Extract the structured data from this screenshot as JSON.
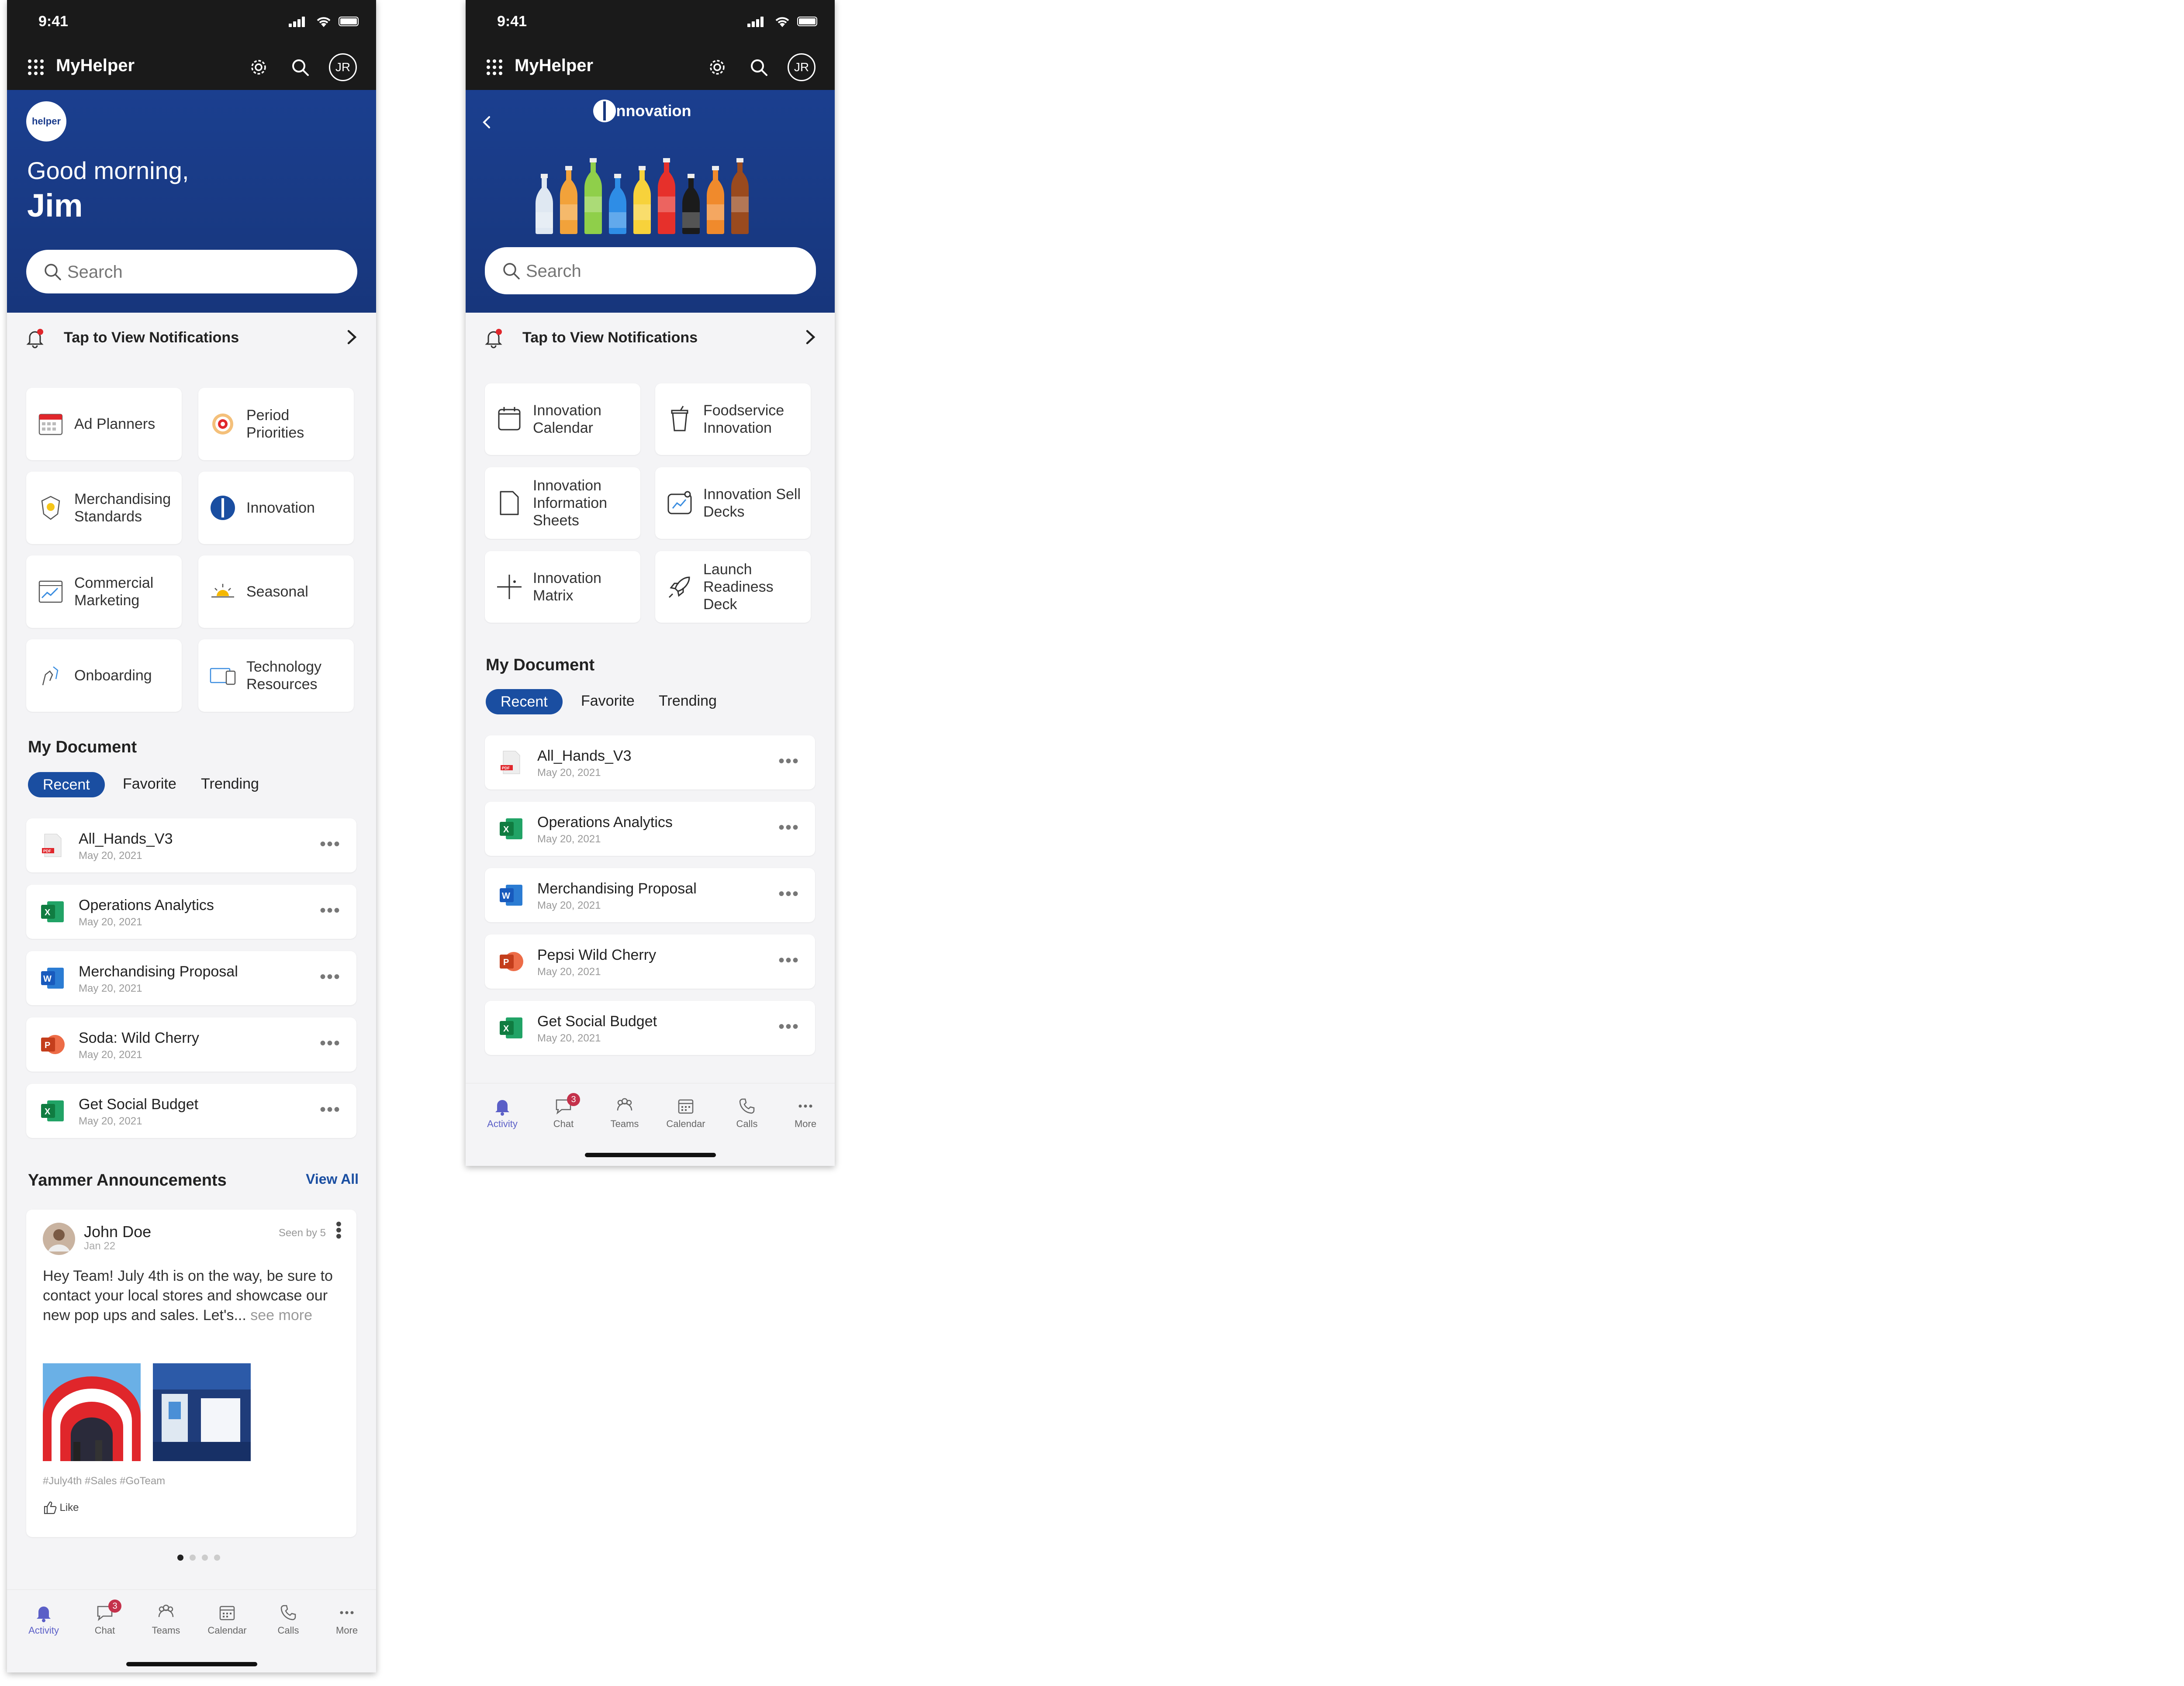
{
  "status": {
    "time": "9:41"
  },
  "app": {
    "name": "MyHelper",
    "avatar_initials": "JR",
    "logo_text": "helper"
  },
  "home": {
    "greeting": "Good morning,",
    "name": "Jim",
    "search_placeholder": "Search",
    "notifications": "Tap to View Notifications",
    "tiles": [
      {
        "label": "Ad Planners",
        "icon": "calendar-icon"
      },
      {
        "label": "Period Priorities",
        "icon": "target-icon"
      },
      {
        "label": "Merchandising Standards",
        "icon": "badge-icon"
      },
      {
        "label": "Innovation",
        "icon": "innovation-logo-icon"
      },
      {
        "label": "Commercial Marketing",
        "icon": "chart-icon"
      },
      {
        "label": "Seasonal",
        "icon": "sun-icon"
      },
      {
        "label": "Onboarding",
        "icon": "handshake-icon"
      },
      {
        "label": "Technology Resources",
        "icon": "devices-icon"
      }
    ],
    "my_document": {
      "title": "My Document",
      "tabs": [
        "Recent",
        "Favorite",
        "Trending"
      ],
      "docs": [
        {
          "name": "All_Hands_V3",
          "date": "May 20, 2021",
          "type": "pdf"
        },
        {
          "name": "Operations Analytics",
          "date": "May 20, 2021",
          "type": "excel"
        },
        {
          "name": "Merchandising Proposal",
          "date": "May 20, 2021",
          "type": "word"
        },
        {
          "name": "Soda: Wild Cherry",
          "date": "May 20, 2021",
          "type": "powerpoint"
        },
        {
          "name": "Get Social Budget",
          "date": "May 20, 2021",
          "type": "excel"
        }
      ]
    },
    "yammer": {
      "title": "Yammer Announcements",
      "view_all": "View All",
      "post": {
        "author": "John Doe",
        "date": "Jan 22",
        "seen": "Seen by 5",
        "text": "Hey Team! July 4th is on the way, be sure to contact your local stores and showcase our new pop ups and sales. Let's...",
        "see_more": "see more",
        "hashtags": "#July4th #Sales #GoTeam",
        "like": "Like"
      }
    }
  },
  "innovation": {
    "logo_text": "nnovation",
    "search_placeholder": "Search",
    "notifications": "Tap to View Notifications",
    "bottle_colors": [
      "#dfe8f2",
      "#f2a23a",
      "#8fcf4a",
      "#2e8de6",
      "#f7d23b",
      "#e6302b",
      "#1b1b1b",
      "#f08a2c",
      "#9a4a1e"
    ],
    "tiles": [
      {
        "label": "Innovation Calendar",
        "icon": "calendar-outline-icon"
      },
      {
        "label": "Foodservice Innovation",
        "icon": "cup-icon"
      },
      {
        "label": "Innovation Information Sheets",
        "icon": "document-icon"
      },
      {
        "label": "Innovation Sell Decks",
        "icon": "chart-box-icon"
      },
      {
        "label": "Innovation Matrix",
        "icon": "matrix-icon"
      },
      {
        "label": "Launch Readiness Deck",
        "icon": "rocket-icon"
      }
    ],
    "my_document": {
      "title": "My Document",
      "tabs": [
        "Recent",
        "Favorite",
        "Trending"
      ],
      "docs": [
        {
          "name": "All_Hands_V3",
          "date": "May 20, 2021",
          "type": "pdf"
        },
        {
          "name": "Operations Analytics",
          "date": "May 20, 2021",
          "type": "excel"
        },
        {
          "name": "Merchandising Proposal",
          "date": "May 20, 2021",
          "type": "word"
        },
        {
          "name": "Pepsi Wild Cherry",
          "date": "May 20, 2021",
          "type": "powerpoint"
        },
        {
          "name": "Get Social Budget",
          "date": "May 20, 2021",
          "type": "excel"
        }
      ]
    }
  },
  "tabbar": {
    "items": [
      {
        "label": "Activity",
        "icon": "bell-icon"
      },
      {
        "label": "Chat",
        "icon": "chat-icon"
      },
      {
        "label": "Teams",
        "icon": "teams-icon"
      },
      {
        "label": "Calendar",
        "icon": "calendar-icon"
      },
      {
        "label": "Calls",
        "icon": "phone-icon"
      },
      {
        "label": "More",
        "icon": "more-icon"
      }
    ],
    "chat_badge": "3"
  },
  "colors": {
    "hero": "#17377e",
    "accent": "#1a4ea1",
    "topbar": "#1a1a1a",
    "badge": "#c4314b",
    "active_tab": "#5b5fc7"
  }
}
